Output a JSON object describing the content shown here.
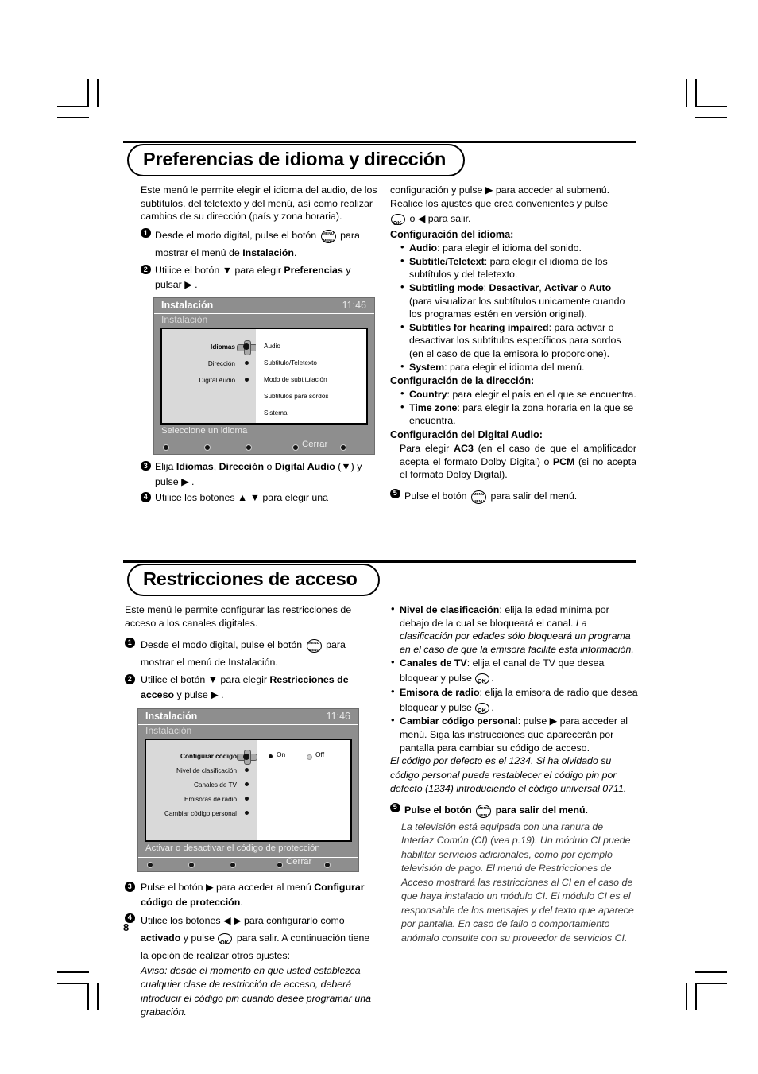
{
  "page_number": "8",
  "sections": [
    {
      "title": "Preferencias de idioma y dirección",
      "left": {
        "intro": "Este menú le permite elegir el idioma del audio, de los subtítulos, del teletexto y del menú, así como realizar cambios de su dirección (país y zona horaria).",
        "steps": [
          {
            "num": "1",
            "a": "Desde el modo digital, pulse el botón",
            "icon": "menu-button-icon",
            "b": "para mostrar el menú de",
            "bold": "Instalación",
            "c": "."
          },
          {
            "num": "2",
            "a": "Utilice el botón ▼ para elegir",
            "bold": "Preferencias",
            "b": "y pulsar ▶ ."
          },
          {
            "num": "3",
            "a": "Elija",
            "bold1": "Idiomas",
            "sep1": ",",
            "bold2": "Dirección",
            "sep2": "o",
            "bold3": "Digital Audio",
            "b": "(▼) y pulse ▶ ."
          },
          {
            "num": "4",
            "a": "Utilice los botones ▲ ▼ para elegir una"
          }
        ]
      },
      "right": {
        "cont": "configuración y pulse ▶ para acceder al submenú. Realice los ajustes que crea convenientes y pulse",
        "cont2_pre": "",
        "cont2_post": "o ◀ para salir.",
        "groups": [
          {
            "heading": "Configuración del idioma:",
            "items": [
              {
                "term": "Audio",
                "rest": ": para elegir el idioma del sonido."
              },
              {
                "term": "Subtitle/Teletext",
                "rest": ": para elegir el idioma de los subtítulos y del teletexto."
              },
              {
                "term": "Subtitling mode",
                "rest": ":",
                "bolds": [
                  "Desactivar",
                  "Activar",
                  "Auto"
                ],
                "joiner": ",",
                "joiner2": "o",
                "extra": "(para visualizar los subtítulos unicamente cuando los programas estén en versión original)."
              },
              {
                "term": "Subtitles for hearing impaired",
                "rest": ": para activar o desactivar los subtítulos específicos para sordos (en el caso de que la emisora lo proporcione)."
              },
              {
                "term": "System",
                "rest": ": para elegir el idioma del menú."
              }
            ]
          },
          {
            "heading": "Configuración de la dirección:",
            "items": [
              {
                "term": "Country",
                "rest": ": para elegir el país en el que se encuentra."
              },
              {
                "term": "Time zone",
                "rest": ": para elegir la zona horaria en la que se encuentra."
              }
            ]
          },
          {
            "heading": "Configuración del Digital Audio:",
            "para_a": "Para elegir",
            "para_b1": "AC3",
            "para_c": "(en el caso de que el amplificador acepta el formato Dolby Digital) o",
            "para_b2": "PCM",
            "para_d": "(si no acepta el formato Dolby Digital)."
          }
        ],
        "final_step": {
          "num": "5",
          "a": "Pulse el botón",
          "icon": "menu-button-icon",
          "b": "para salir del menú."
        }
      },
      "tv": {
        "header_title": "Instalación",
        "clock": "11:46",
        "breadcrumb": "Instalación",
        "menu_items": [
          {
            "label": "Idiomas",
            "selected": true
          },
          {
            "label": "Dirección",
            "selected": false
          },
          {
            "label": "Digital Audio",
            "selected": false
          }
        ],
        "right_items": [
          "Audio",
          "Subtitulo/Teletexto",
          "Modo de subtitulación",
          "Subtitulos para sordos",
          "Sistema"
        ],
        "status": "Seleccione un idioma",
        "close_label": "Cerrar"
      }
    },
    {
      "title": "Restricciones de acceso",
      "left": {
        "intro": "Este menú le permite configurar las restricciones de acceso a los canales digitales.",
        "steps": [
          {
            "num": "1",
            "a": "Desde el modo digital, pulse el botón",
            "icon": "menu-button-icon",
            "b": "para mostrar el menú de Instalación."
          },
          {
            "num": "2",
            "a": "Utilice el botón ▼ para elegir",
            "bold": "Restricciones de acceso",
            "b": "y pulse ▶ ."
          },
          {
            "num": "3",
            "a": "Pulse el botón ▶ para acceder al menú",
            "bold": "Configurar código de protección",
            "b": "."
          },
          {
            "num": "4",
            "a": "Utilice los botones ◀ ▶ para  configurarlo como",
            "bold": "activado",
            "b": "y pulse",
            "icon": "ok-button-icon",
            "c": "para salir. A continuación tiene la opción de realizar otros ajustes:"
          }
        ],
        "notice_label": "Aviso",
        "notice": ": desde el momento en que usted establezca cualquier clase de restricción de acceso, deberá introducir el código pin cuando desee programar una grabación."
      },
      "right": {
        "items": [
          {
            "term": "Nivel de clasificación",
            "rest": ": elija la edad mínima por debajo de la cual se bloqueará el canal.",
            "italic": "La clasificación por edades sólo bloqueará un programa en el caso de que la emisora facilite esta información."
          },
          {
            "term": "Canales de TV",
            "rest": ": elija el canal de TV que desea bloquear y pulse",
            "icon": "ok-button-icon",
            "tail": "."
          },
          {
            "term": "Emisora de radio",
            "rest": ": elija la emisora de radio que desea bloquear y pulse",
            "icon": "ok-button-icon",
            "tail": "."
          },
          {
            "term": "Cambiar código personal",
            "rest": ": pulse ▶ para acceder al menú. Siga las instrucciones que aparecerán por pantalla para cambiar su código de acceso."
          }
        ],
        "italic_note": "El código por defecto es el 1234. Si ha olvidado su código personal puede restablecer el código pin por defecto (1234) introduciendo el código universal 0711.",
        "final_step": {
          "num": "5",
          "a": "Pulse el botón",
          "icon": "menu-button-icon",
          "b": "para salir del menú."
        },
        "ci_note": "La televisión está equipada con una ranura de Interfaz Común (CI) (vea p.19). Un módulo CI puede habilitar servicios adicionales, como por ejemplo televisión de pago. El menú de Restricciones de Acceso mostrará las restricciones al CI en el caso de que haya instalado un módulo CI. El módulo CI es el responsable de los mensajes y del texto que aparece por pantalla. En caso de fallo o comportamiento anómalo consulte con su proveedor de servicios CI."
      },
      "tv": {
        "header_title": "Instalación",
        "clock": "11:46",
        "breadcrumb": "Instalación",
        "menu_items": [
          {
            "label": "Configurar código",
            "selected": true
          },
          {
            "label": "Nivel de clasificación",
            "selected": false
          },
          {
            "label": "Canales de TV",
            "selected": false
          },
          {
            "label": "Emisoras de radio",
            "selected": false
          },
          {
            "label": "Cambiar código personal",
            "selected": false
          }
        ],
        "options": [
          {
            "label": "On",
            "checked": true
          },
          {
            "label": "Off",
            "checked": false
          }
        ],
        "status": "Activar o desactivar el código de protección",
        "close_label": "Cerrar"
      }
    }
  ],
  "colors": {
    "tv_chrome": "#8e8e8e",
    "tv_panel": "#d9d9d9",
    "tv_text": "#ffffff",
    "ink": "#000000"
  }
}
